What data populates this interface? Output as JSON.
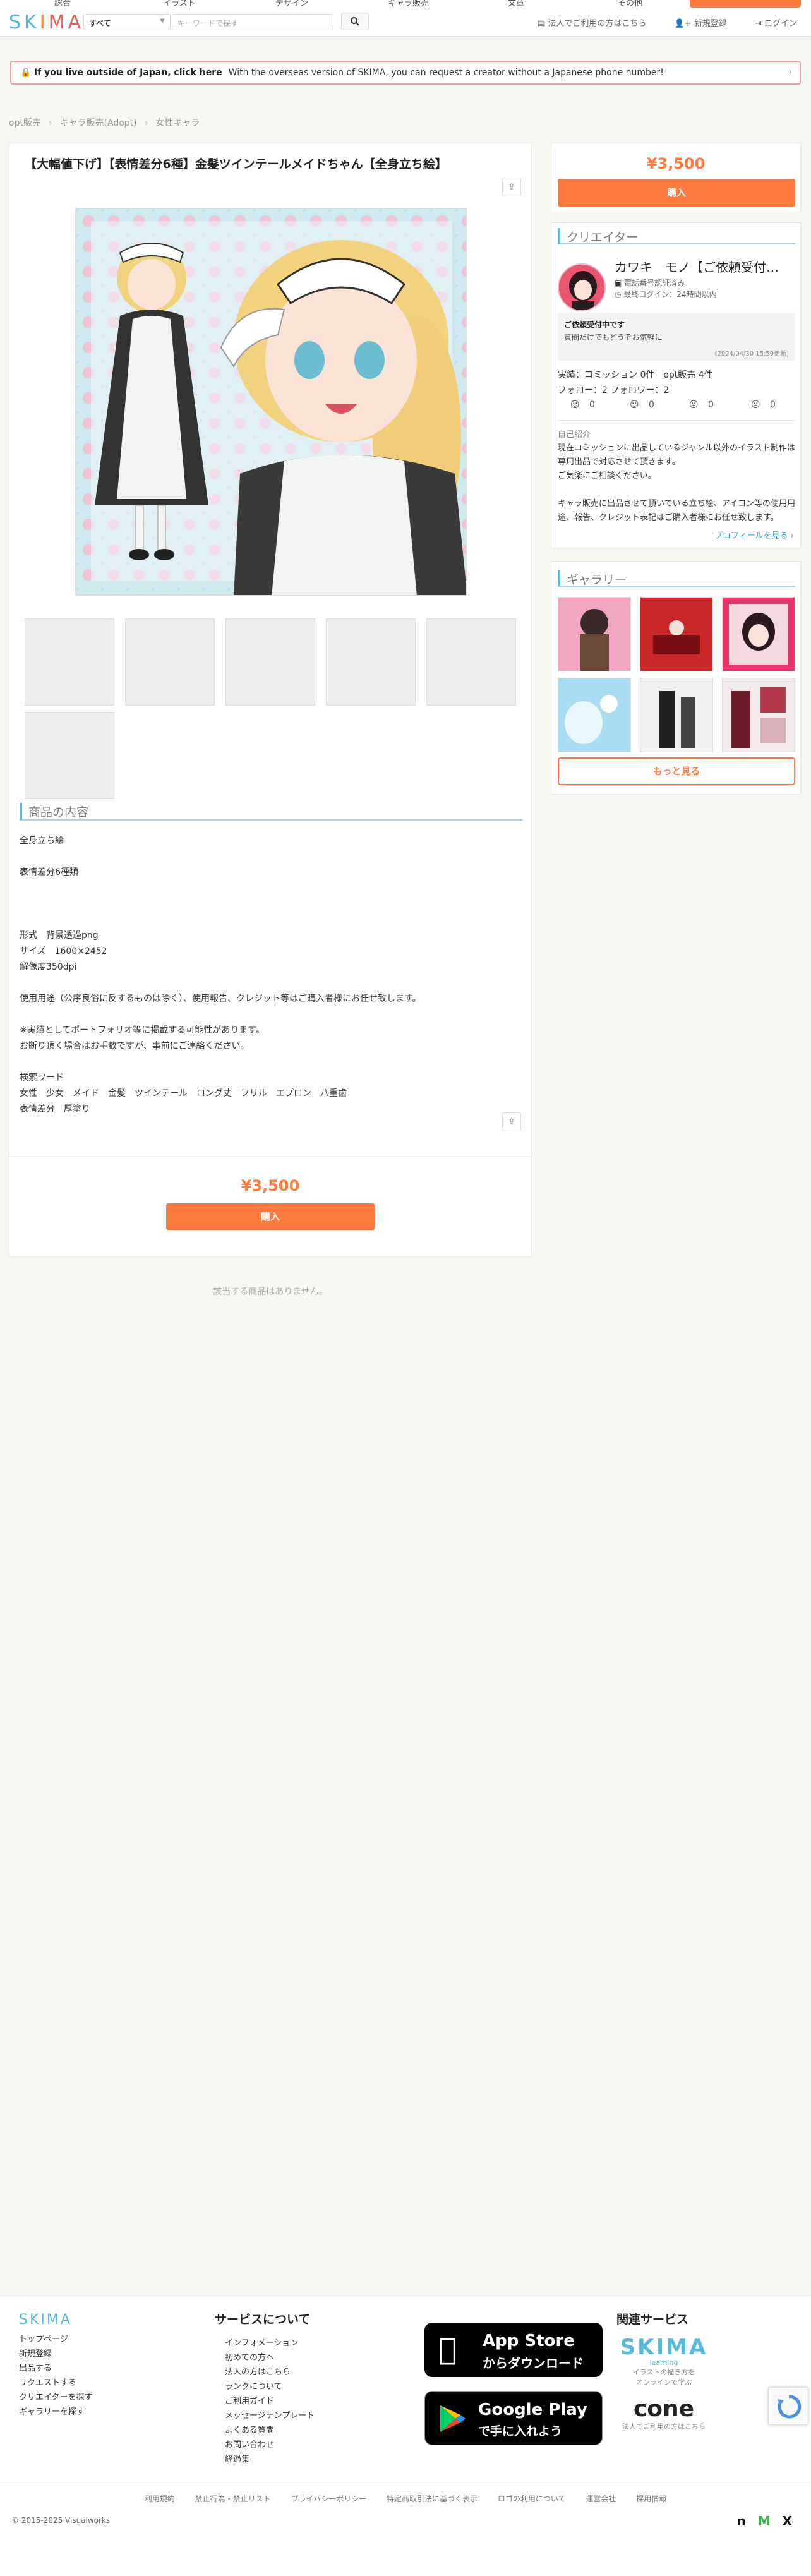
{
  "header": {
    "logo": "SKIMA",
    "top_nav": [
      "総合",
      "イラスト",
      "デザイン",
      "キャラ販売",
      "文章",
      "その他"
    ],
    "category_select": "すべて",
    "search_placeholder": "キーワードで探す",
    "links": [
      "法人でご利用の方はこちら",
      "新規登録",
      "ログイン"
    ]
  },
  "notice": {
    "title": "If you live outside of Japan, click here",
    "body": "With the overseas version of SKIMA, you can request a creator without a Japanese phone number!"
  },
  "breadcrumb": [
    "opt販売",
    "キャラ販売(Adopt)",
    "女性キャラ"
  ],
  "product": {
    "title": "【大幅値下げ】【表情差分6種】金髪ツインテールメイドちゃん【全身立ち絵】",
    "section_title": "商品の内容",
    "description": [
      "全身立ち絵",
      "",
      "表情差分6種類",
      "",
      "",
      "",
      "形式　背景透過png",
      "サイズ　1600×2452",
      "解像度350dpi",
      "",
      "使用用途（公序良俗に反するものは除く）、使用報告、クレジット等はご購入者様にお任せ致します。",
      "",
      "※実績としてポートフォリオ等に掲載する可能性があります。",
      "お断り頂く場合はお手数ですが、事前にご連絡ください。",
      "",
      "検索ワード",
      "女性　少女　メイド　金髪　ツインテール　ロング丈　フリル　エプロン　八重歯",
      "表情差分　厚塗り"
    ],
    "price": "¥3,500",
    "buy_label": "購入",
    "no_items": "該当する商品はありません。"
  },
  "sidebar": {
    "price": "¥3,500",
    "buy_label": "購入",
    "creator_heading": "クリエイター",
    "creator_name": "カワキ　モノ【ご依頼受付…",
    "phone_verified": "電話番号認証済み",
    "last_login": "最終ログイン：24時間以内",
    "status_title": "ご依頼受付中です",
    "status_body": "質問だけでもどうぞお気軽に",
    "status_date": "(2024/04/30 15:59更新)",
    "stats": "実績：コミッション 0件　opt販売 4件",
    "follow": "フォロー：2 フォロワー：2",
    "ratings": [
      "0",
      "0",
      "0",
      "0"
    ],
    "intro_label": "自己紹介",
    "intro": [
      "現在コミッションに出品しているジャンル以外のイラスト制作は専用出品で対応させて頂きます。",
      "ご気楽にご相談ください。",
      "",
      "キャラ販売に出品させて頂いている立ち絵、アイコン等の使用用途、報告、クレジット表記はご購入者様にお任せ致します。"
    ],
    "profile_link": "プロフィールを見る ›",
    "gallery_heading": "ギャラリー",
    "more_label": "もっと見る"
  },
  "footer": {
    "brand": "SKIMA",
    "links_col1": [
      "トップページ",
      "新規登録",
      "出品する",
      "リクエストする",
      "クリエイターを探す",
      "ギャラリーを探す"
    ],
    "services_heading": "サービスについて",
    "services": [
      "インフォメーション",
      "初めての方へ",
      "法人の方はこちら",
      "ランクについて",
      "ご利用ガイド",
      "メッセージテンプレート",
      "よくある質問",
      "お問い合わせ",
      "経過集"
    ],
    "appstore_line1": "App Store",
    "appstore_line2": "からダウンロード",
    "googleplay_line1": "Google Play",
    "googleplay_line2": "で手に入れよう",
    "related_heading": "関連サービス",
    "learning_name": "SKIMA",
    "learning_sub": "learning",
    "learning_desc1": "イラストの描き方を",
    "learning_desc2": "オンラインで学ぶ",
    "cone_name": "cone",
    "cone_desc": "法人でご利用の方はこちら",
    "bottom_links": [
      "利用規約",
      "禁止行為・禁止リスト",
      "プライバシーポリシー",
      "特定商取引法に基づく表示",
      "ロゴの利用について",
      "運営会社",
      "採用情報"
    ],
    "copyright": "© 2015-2025 Visualworks"
  }
}
